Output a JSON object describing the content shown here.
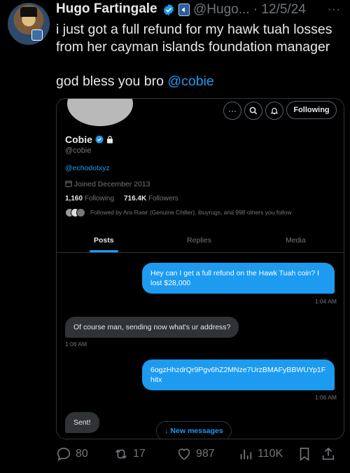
{
  "tweet": {
    "author_name": "Hugo Fartingale",
    "handle_date": "@Hugo... · 12/5/24",
    "more": "···",
    "line1": "i just got a full refund for my hawk tuah losses from her cayman islands foundation manager",
    "line2_prefix": "god bless you bro ",
    "line2_mention": "@cobie"
  },
  "profile": {
    "following_button": "Following",
    "name": "Cobie",
    "handle": "@cobie",
    "link": "@echodotxyz",
    "joined": "Joined December 2013",
    "following_count": "1,160",
    "following_label": "Following",
    "followers_count": "716.4K",
    "followers_label": "Followers",
    "followed_by": "Followed by Ara Rawr (Genuine Chiller), ibuyrugs, and 998 others you follow",
    "tabs": [
      "Posts",
      "Replies",
      "Media"
    ]
  },
  "messages": [
    {
      "text": "Hey can I get a full refund on the Hawk Tuah coin? I lost $28,000",
      "time": "1:04 AM"
    },
    {
      "text": "Of course man, sending now what's ur address?",
      "time": "1:06 AM"
    },
    {
      "text": "6ogzHhzdrQr9Pgv6hZ2MNze7UrzBMAFyBBWUYp1Fhitx",
      "time": "1:06 AM"
    },
    {
      "text": "Sent!"
    }
  ],
  "new_messages": "↓ New messages",
  "actions": {
    "replies": "80",
    "reposts": "17",
    "likes": "987",
    "views": "110K"
  },
  "colors": {
    "accent": "#1d9bf0",
    "muted": "#71767b",
    "background": "#000000"
  }
}
